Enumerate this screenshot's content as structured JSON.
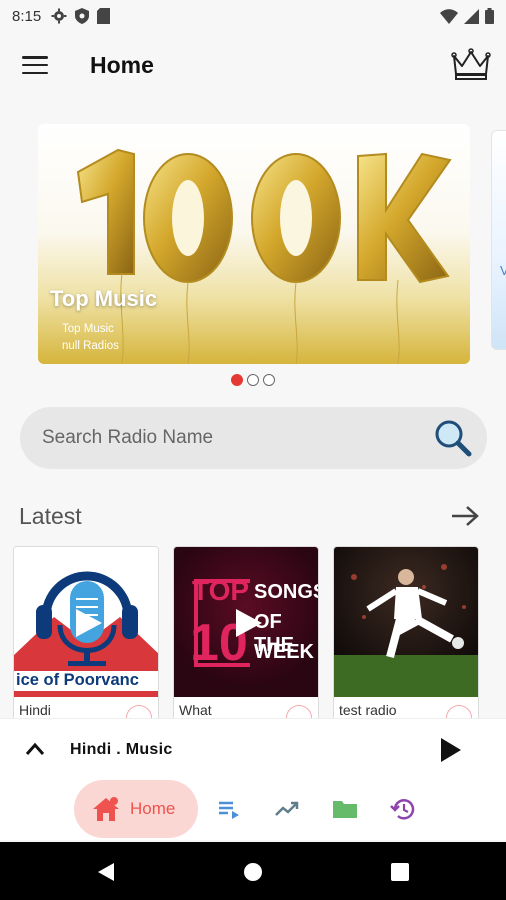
{
  "status_bar": {
    "time": "8:15"
  },
  "app_bar": {
    "title": "Home"
  },
  "banner": {
    "title": "Top Music",
    "subtitle1": "Top Music",
    "subtitle2": "null Radios",
    "next_peek_text": "V"
  },
  "carousel": {
    "page_count": 3,
    "active_index": 0
  },
  "search": {
    "placeholder": "Search Radio Name"
  },
  "latest": {
    "title": "Latest",
    "cards": [
      {
        "name": "Hindi",
        "thumb_text": "ice of Poorvanc"
      },
      {
        "name": "What",
        "thumb_text_top": "TOP",
        "thumb_text_num": "10",
        "thumb_text_right1": "SONGS",
        "thumb_text_right2": "OF THE",
        "thumb_text_right3": "WEEK"
      },
      {
        "name": "test radio"
      }
    ]
  },
  "mini_player": {
    "now_playing": "Hindi . Music"
  },
  "bottom_nav": {
    "home_label": "Home"
  },
  "colors": {
    "accent": "#ef5350",
    "home_pill": "#fbd7d3",
    "search_bg": "#e7e7e7",
    "gold": "#d6b53c"
  }
}
